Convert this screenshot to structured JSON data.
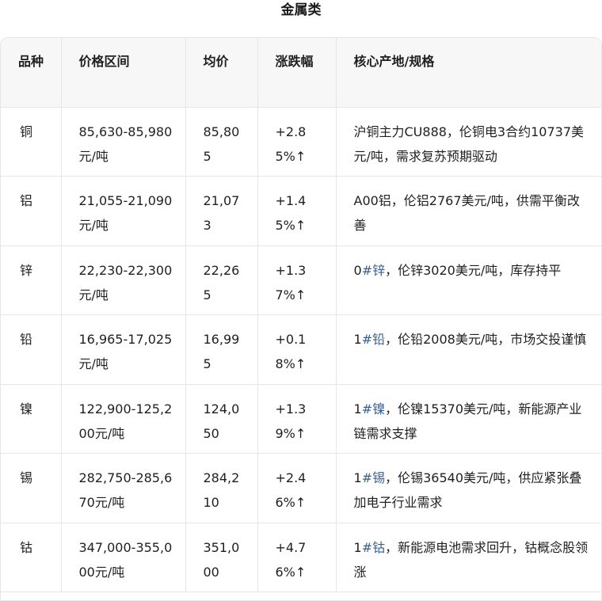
{
  "title": "金属类",
  "headers": [
    "品种",
    "价格区间",
    "均价",
    "涨跌幅",
    "核心产地/规格"
  ],
  "rows": [
    {
      "name": "铜",
      "range": "85,630-85,980元/吨",
      "avg": "85,805",
      "change": "+2.85%↑",
      "spec_prefix": "",
      "spec_hash": "",
      "spec_text": "沪铜主力CU888，伦铜电3合约10737美元/吨，需求复苏预期驱动"
    },
    {
      "name": "铝",
      "range": "21,055-21,090元/吨",
      "avg": "21,073",
      "change": "+1.45%↑",
      "spec_prefix": "",
      "spec_hash": "",
      "spec_text": "A00铝，伦铝2767美元/吨，供需平衡改善"
    },
    {
      "name": "锌",
      "range": "22,230-22,300元/吨",
      "avg": "22,265",
      "change": "+1.37%↑",
      "spec_prefix": "0",
      "spec_hash": "#锌",
      "spec_text": "，伦锌3020美元/吨，库存持平"
    },
    {
      "name": "铅",
      "range": "16,965-17,025元/吨",
      "avg": "16,995",
      "change": "+0.18%↑",
      "spec_prefix": "1",
      "spec_hash": "#铅",
      "spec_text": "，伦铅2008美元/吨，市场交投谨慎"
    },
    {
      "name": "镍",
      "range": "122,900-125,200元/吨",
      "avg": "124,050",
      "change": "+1.39%↑",
      "spec_prefix": "1",
      "spec_hash": "#镍",
      "spec_text": "，伦镍15370美元/吨，新能源产业链需求支撑"
    },
    {
      "name": "锡",
      "range": "282,750-285,670元/吨",
      "avg": "284,210",
      "change": "+2.46%↑",
      "spec_prefix": "1",
      "spec_hash": "#锡",
      "spec_text": "，伦锡36540美元/吨，供应紧张叠加电子行业需求"
    },
    {
      "name": "钴",
      "range": "347,000-355,000元/吨",
      "avg": "351,000",
      "change": "+4.76%↑",
      "spec_prefix": "1",
      "spec_hash": "#钴",
      "spec_text": "，新能源电池需求回升，钴概念股领涨"
    }
  ]
}
